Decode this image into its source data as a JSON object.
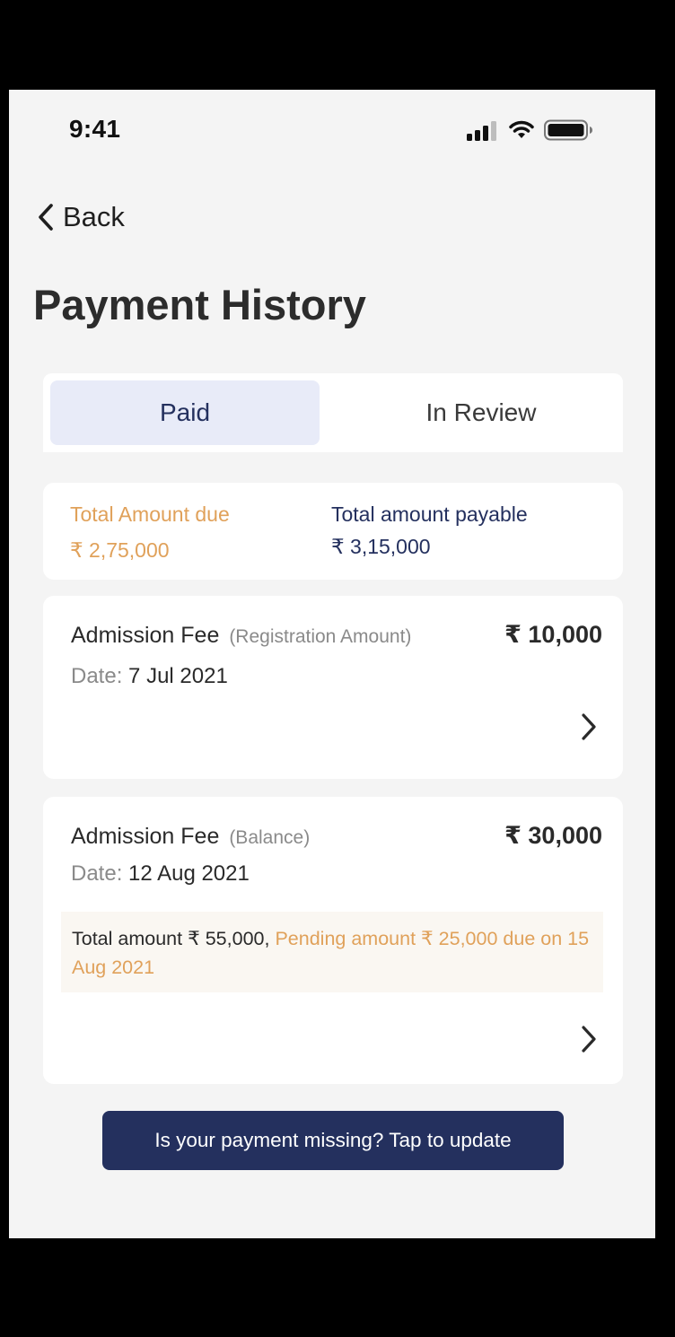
{
  "status_bar": {
    "time": "9:41",
    "icons": [
      "signal-icon",
      "wifi-icon",
      "battery-icon"
    ]
  },
  "nav": {
    "back_label": "Back",
    "back_icon": "chevron-left-icon"
  },
  "page": {
    "title": "Payment History"
  },
  "tabs": [
    {
      "label": "Paid",
      "selected": true
    },
    {
      "label": "In Review",
      "selected": false
    }
  ],
  "summary": {
    "due_label": "Total Amount due",
    "due_value": "₹ 2,75,000",
    "payable_label": "Total amount payable",
    "payable_value": "₹ 3,15,000"
  },
  "payments": [
    {
      "title": "Admission Fee",
      "subtitle": "(Registration Amount)",
      "amount": "₹ 10,000",
      "date_label": "Date:",
      "date": "7 Jul 2021"
    },
    {
      "title": "Admission Fee",
      "subtitle": "(Balance)",
      "amount": "₹ 30,000",
      "date_label": "Date:",
      "date": "12 Aug 2021",
      "note_total": "Total amount ₹ 55,000,",
      "note_pending": "Pending amount ₹ 25,000 due on 15 Aug 2021"
    }
  ],
  "cta": {
    "label": "Is your payment missing? Tap to update"
  },
  "colors": {
    "primary": "#24305e",
    "accent_orange": "#e0a15a",
    "tab_selected_bg": "#e8ebf8",
    "background": "#f4f4f4"
  }
}
